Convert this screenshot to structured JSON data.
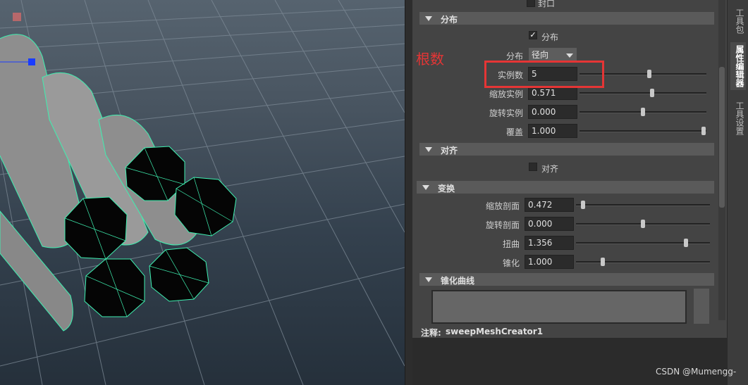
{
  "viewport": {},
  "panel": {
    "cap_label": "封口",
    "sections": {
      "distribute": "分布",
      "align": "对齐",
      "transform": "变换",
      "taper_curve": "锥化曲线"
    },
    "distribute": {
      "checkbox_label": "分布",
      "checked": true,
      "mode_label": "分布",
      "mode_value": "径向",
      "instances_label": "实例数",
      "instances_value": "5",
      "instances_level": 0.55,
      "scale_instance_label": "缩放实例",
      "scale_instance_value": "0.571",
      "scale_instance_level": 0.57,
      "rotate_instance_label": "旋转实例",
      "rotate_instance_value": "0.000",
      "rotate_instance_level": 0.5,
      "coverage_label": "覆盖",
      "coverage_value": "1.000",
      "coverage_level": 0.98
    },
    "align": {
      "checkbox_label": "对齐",
      "checked": false
    },
    "transform": {
      "scale_profile_label": "缩放剖面",
      "scale_profile_value": "0.472",
      "scale_profile_level": 0.05,
      "rotate_profile_label": "旋转剖面",
      "rotate_profile_value": "0.000",
      "rotate_profile_level": 0.5,
      "twist_label": "扭曲",
      "twist_value": "1.356",
      "twist_level": 0.82,
      "taper_label": "锥化",
      "taper_value": "1.000",
      "taper_level": 0.2
    }
  },
  "notes": {
    "label": "注释:",
    "node_name": "sweepMeshCreator1"
  },
  "right_tabs": {
    "toolbox": "工具包",
    "attribute_editor": "属性编辑器",
    "tool_settings": "工具设置"
  },
  "annotation": {
    "text": "根数",
    "color": "#e53535"
  },
  "watermark": "CSDN @Mumengg-"
}
